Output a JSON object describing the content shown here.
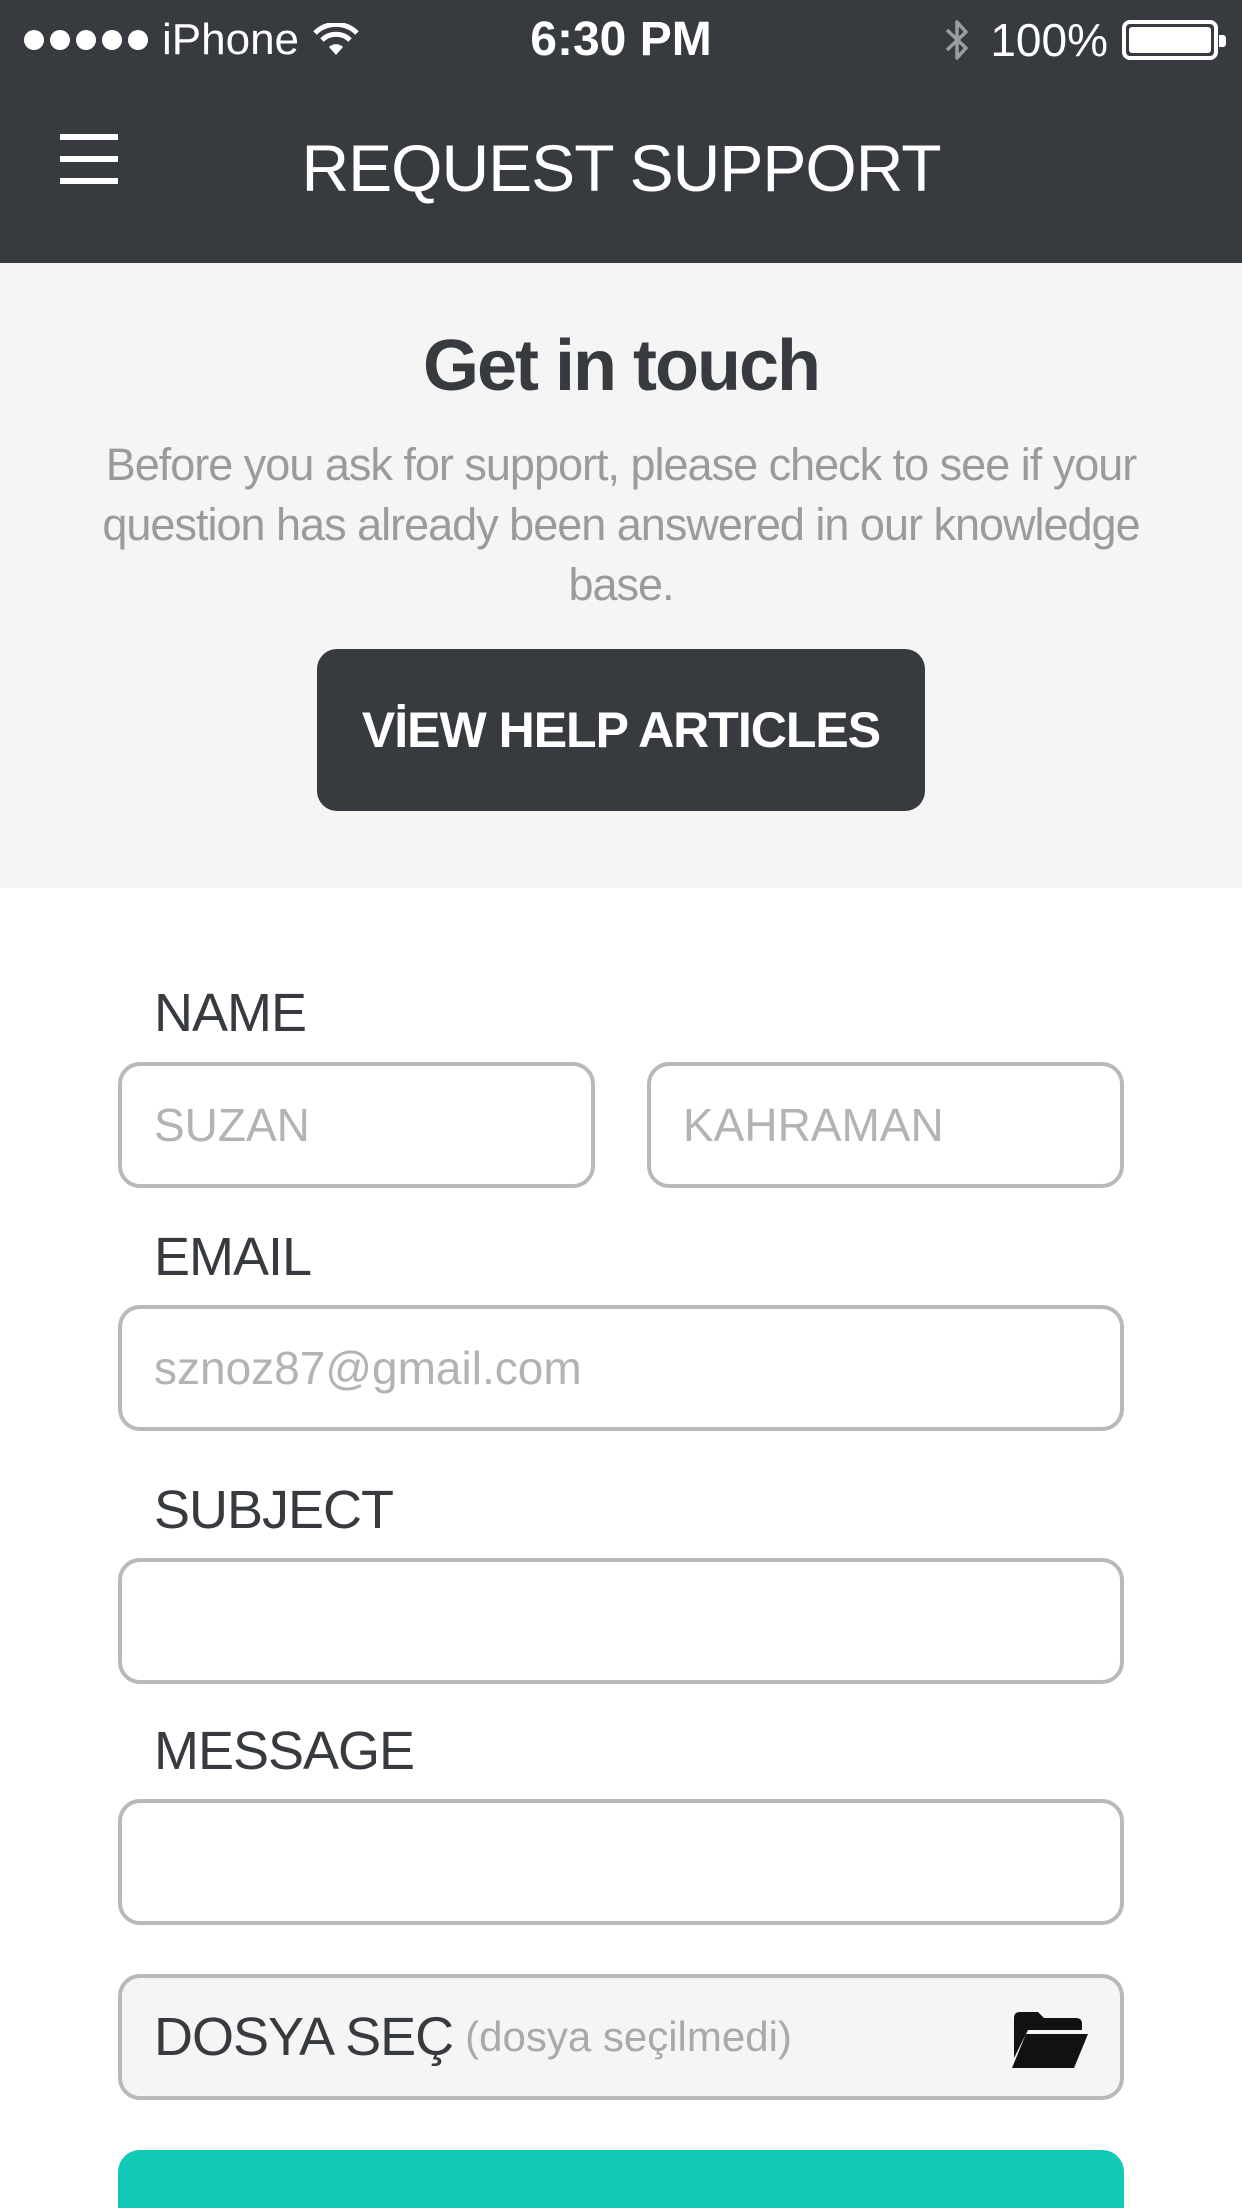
{
  "status_bar": {
    "carrier": "iPhone",
    "time": "6:30 PM",
    "battery_percent": "100%"
  },
  "header": {
    "title": "REQUEST SUPPORT",
    "menu_icon": "hamburger-menu-icon"
  },
  "intro": {
    "heading": "Get in touch",
    "description": "Before you ask for support, please check to see if your question has already been answered in our knowledge base.",
    "button_label": "VİEW HELP ARTICLES"
  },
  "form": {
    "name_label": "NAME",
    "first_name_value": "SUZAN",
    "last_name_value": "KAHRAMAN",
    "email_label": "EMAIL",
    "email_value": "sznoz87@gmail.com",
    "subject_label": "SUBJECT",
    "subject_value": "",
    "message_label": "MESSAGE",
    "message_value": "",
    "file_button_label": "DOSYA SEÇ",
    "file_status": "(dosya seçilmedi)",
    "file_icon": "folder-icon"
  },
  "colors": {
    "header_bg": "#373b3f",
    "intro_bg": "#f5f5f5",
    "accent": "#10c9b7",
    "field_border": "#b9b9b9"
  }
}
